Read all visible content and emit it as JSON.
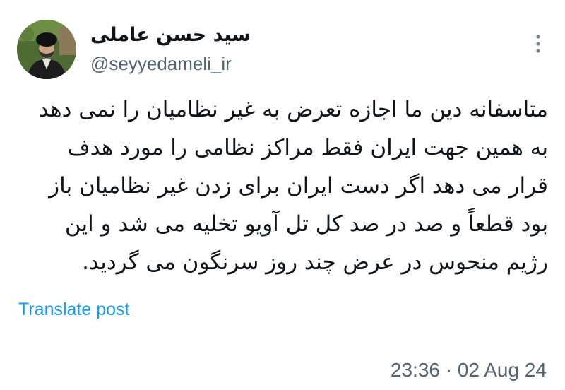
{
  "author": {
    "display_name": "سید حسن عاملی",
    "handle": "@seyyedameli_ir",
    "avatar_icon": "profile-photo"
  },
  "post": {
    "text": "متاسفانه دین ما اجازه تعرض به غیر نظامیان را نمی دهد\nبه همین جهت ایران فقط مراکز نظامی را مورد هدف\nقرار می دهد اگر دست ایران برای زدن غیر نظامیان باز\nبود قطعاً و صد در صد کل تل آویو تخلیه می شد و این\nرژیم منحوس در عرض چند روز سرنگون می گردید.",
    "translate_label": "Translate post",
    "time": "23:36",
    "separator": "·",
    "date": "02 Aug 24"
  },
  "menu": {
    "icon": "more-vertical-icon"
  },
  "colors": {
    "text": "#0f1419",
    "secondary": "#536471",
    "link": "#1d9bf0",
    "background": "#ffffff"
  }
}
